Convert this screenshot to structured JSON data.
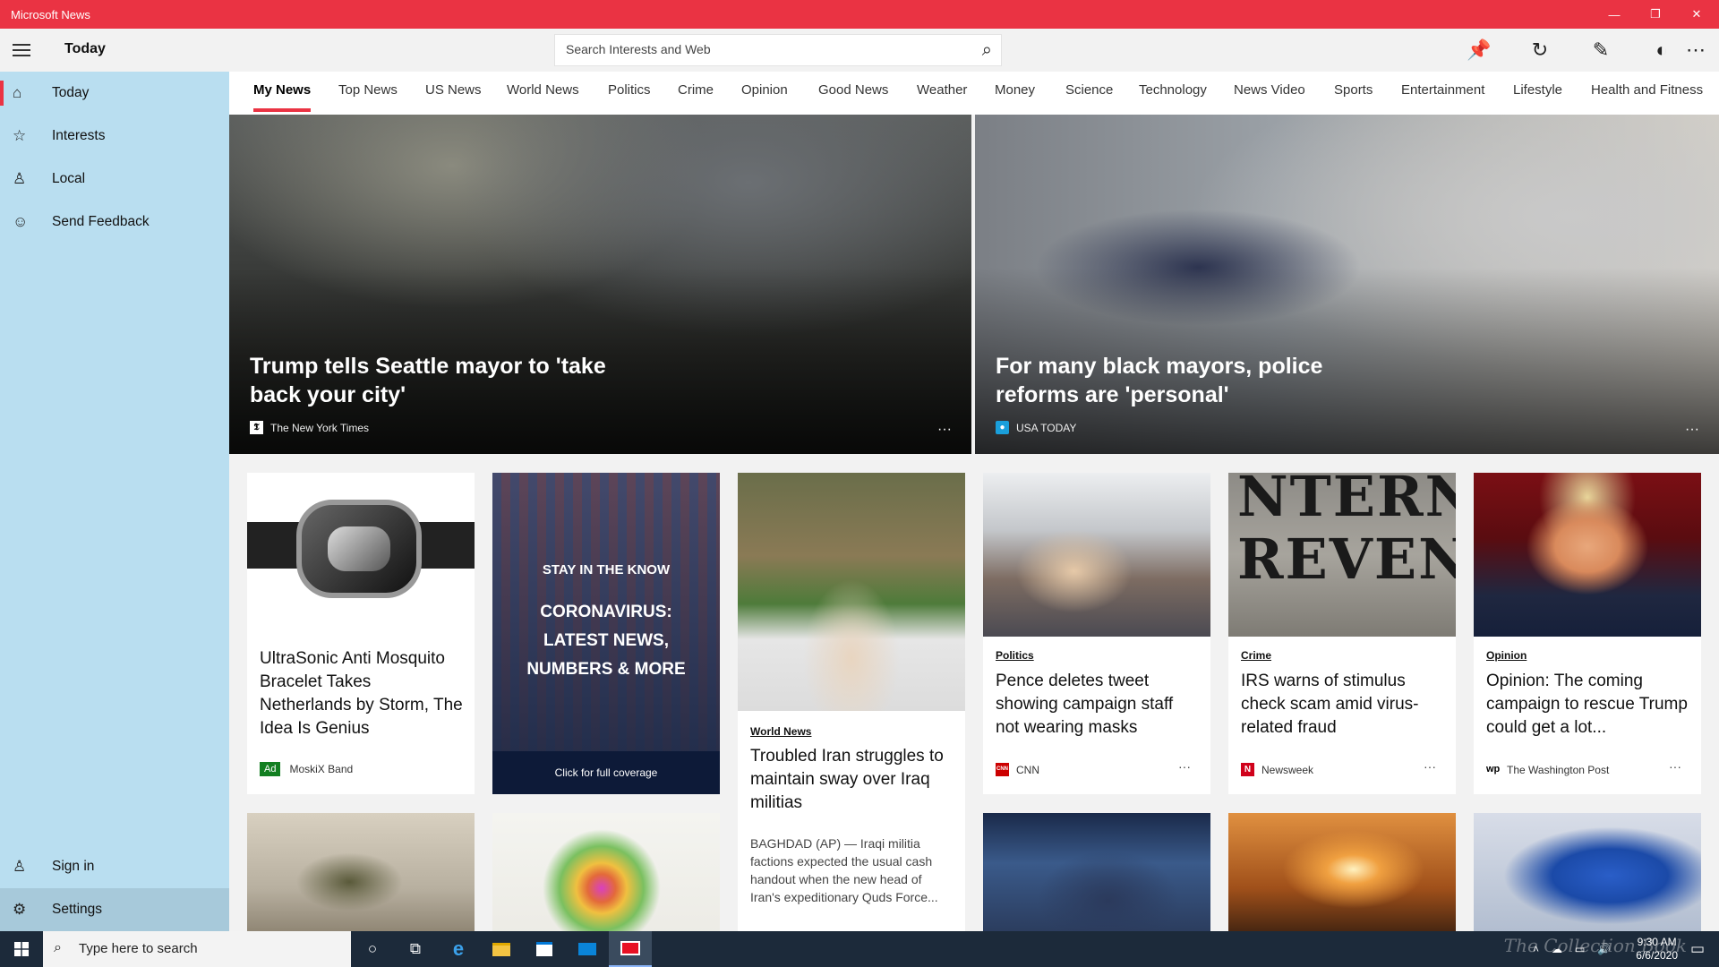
{
  "window": {
    "title": "Microsoft News",
    "minimize": "—",
    "restore": "❐",
    "close": "✕"
  },
  "sidebar": {
    "header": "Today",
    "items": [
      {
        "label": "Today",
        "icon": "home-icon",
        "glyph": "⌂"
      },
      {
        "label": "Interests",
        "icon": "star-list-icon",
        "glyph": "☆"
      },
      {
        "label": "Local",
        "icon": "person-pin-icon",
        "glyph": "♙"
      },
      {
        "label": "Send Feedback",
        "icon": "smiley-icon",
        "glyph": "☺"
      }
    ],
    "bottom": [
      {
        "label": "Sign in",
        "icon": "person-icon",
        "glyph": "♙"
      },
      {
        "label": "Settings",
        "icon": "gear-icon",
        "glyph": "⚙"
      }
    ]
  },
  "search": {
    "placeholder": "Search Interests and Web",
    "icon_glyph": "⌕"
  },
  "header_icons": {
    "pin": "📌",
    "refresh": "↻",
    "edit": "✎",
    "theme": "◐",
    "more": "⋯"
  },
  "tabs": [
    "My News",
    "Top News",
    "US News",
    "World News",
    "Politics",
    "Crime",
    "Opinion",
    "Good News",
    "Weather",
    "Money",
    "Science",
    "Technology",
    "News Video",
    "Sports",
    "Entertainment",
    "Lifestyle",
    "Health and Fitness"
  ],
  "heroes": [
    {
      "title": "Trump tells Seattle mayor to 'take back your city'",
      "source": "The New York Times",
      "logo": "𝕿",
      "more": "···"
    },
    {
      "title": "For many black mayors, police reforms are 'personal'",
      "source": "USA TODAY",
      "logo": "●",
      "more": "···"
    }
  ],
  "cards": {
    "ad": {
      "title": "UltraSonic Anti Mosquito Bracelet Takes Netherlands by Storm, The Idea Is Genius",
      "badge": "Ad",
      "source": "MoskiX Band"
    },
    "promo": {
      "kicker": "STAY IN THE KNOW",
      "headline": "CORONAVIRUS: LATEST NEWS, NUMBERS & MORE",
      "cta": "Click for full coverage"
    },
    "iran": {
      "category": "World News",
      "title": "Troubled Iran struggles to maintain sway over Iraq militias",
      "snippet": "BAGHDAD (AP) — Iraqi militia factions expected the usual cash handout when the new head of Iran's expeditionary Quds Force..."
    },
    "pence": {
      "category": "Politics",
      "title": "Pence deletes tweet showing campaign staff not wearing masks",
      "source": "CNN",
      "logo": "CNN",
      "more": "···"
    },
    "irs": {
      "category": "Crime",
      "title": "IRS warns of stimulus check scam amid virus-related fraud",
      "source": "Newsweek",
      "logo": "N",
      "more": "···"
    },
    "opinion": {
      "category": "Opinion",
      "title": "Opinion: The coming campaign to rescue Trump could get a lot...",
      "source": "The Washington Post",
      "logo": "wp",
      "more": "···"
    },
    "irs_image_text": "NTERN\nREVEN"
  },
  "taskbar": {
    "search_placeholder": "Type here to search",
    "time": "9:30 AM",
    "date": "6/6/2020",
    "watermark": "The Collection Book"
  },
  "colors": {
    "accent": "#ea3343",
    "sidebar": "#b9def0",
    "taskbar": "#1c2a3a"
  }
}
